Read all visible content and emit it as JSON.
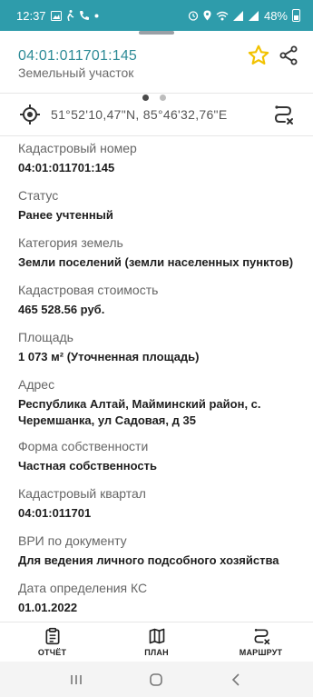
{
  "status_bar": {
    "time": "12:37",
    "left_icons": [
      "gallery-icon",
      "walk-icon",
      "call-icon",
      "dot-icon"
    ],
    "right_icons": [
      "alarm-icon",
      "location-icon",
      "wifi-icon",
      "signal-icon",
      "signal-icon"
    ],
    "battery": "48%",
    "color": "#2e9cab"
  },
  "header": {
    "title": "04:01:011701:145",
    "subtitle": "Земельный участок",
    "star_color": "#f2c200",
    "title_color": "#2e8b97"
  },
  "coordinates": "51°52'10,47\"N, 85°46'32,76\"E",
  "fields": [
    {
      "label": "Кадастровый номер",
      "value": "04:01:011701:145"
    },
    {
      "label": "Статус",
      "value": "Ранее учтенный"
    },
    {
      "label": "Категория земель",
      "value": "Земли поселений (земли населенных пунктов)"
    },
    {
      "label": "Кадастровая стоимость",
      "value": "465 528.56 руб."
    },
    {
      "label": "Площадь",
      "value": "1 073 м² (Уточненная площадь)"
    },
    {
      "label": "Адрес",
      "value": "Республика Алтай, Майминский район, с. Черемшанка, ул Садовая, д 35"
    },
    {
      "label": "Форма собственности",
      "value": "Частная собственность"
    },
    {
      "label": "Кадастровый квартал",
      "value": "04:01:011701"
    },
    {
      "label": "ВРИ по документу",
      "value": "Для ведения личного подсобного хозяйства"
    },
    {
      "label": "Дата определения КС",
      "value": "01.01.2022"
    }
  ],
  "bottom_nav": {
    "report": "ОТЧЁТ",
    "plan": "ПЛАН",
    "route": "МАРШРУТ"
  }
}
